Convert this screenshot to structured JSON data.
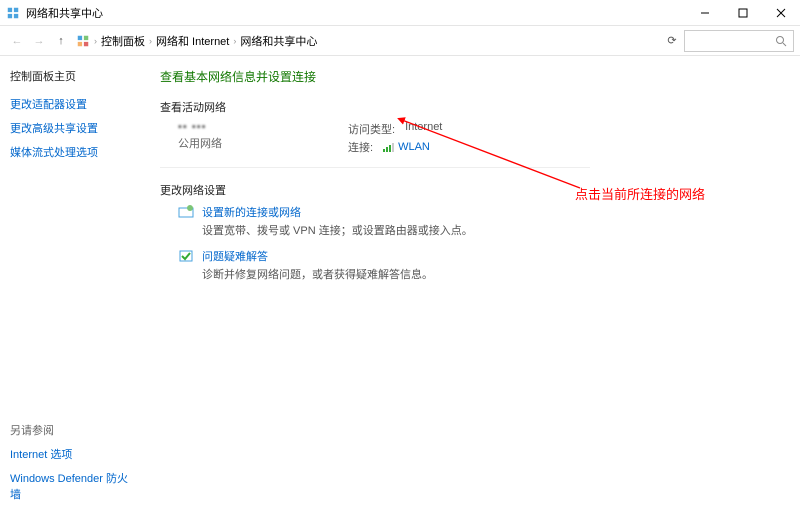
{
  "window": {
    "title": "网络和共享中心"
  },
  "breadcrumb": {
    "items": [
      "控制面板",
      "网络和 Internet",
      "网络和共享中心"
    ]
  },
  "sidebar": {
    "home": "控制面板主页",
    "links": [
      "更改适配器设置",
      "更改高级共享设置",
      "媒体流式处理选项"
    ],
    "see_also": "另请参阅",
    "bottom_links": [
      "Internet 选项",
      "Windows Defender 防火墙"
    ]
  },
  "main": {
    "heading": "查看基本网络信息并设置连接",
    "active_section": "查看活动网络",
    "network": {
      "name": "▪▪ ▪▪▪",
      "type": "公用网络",
      "access_label": "访问类型:",
      "access_value": "Internet",
      "conn_label": "连接:",
      "conn_value": "WLAN"
    },
    "change_section": "更改网络设置",
    "tasks": [
      {
        "title": "设置新的连接或网络",
        "desc": "设置宽带、拨号或 VPN 连接；或设置路由器或接入点。"
      },
      {
        "title": "问题疑难解答",
        "desc": "诊断并修复网络问题，或者获得疑难解答信息。"
      }
    ]
  },
  "annotation": {
    "text": "点击当前所连接的网络"
  }
}
